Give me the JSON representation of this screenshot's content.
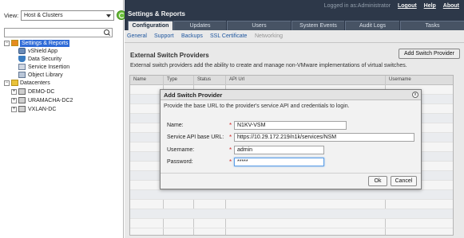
{
  "left": {
    "view_label": "View:",
    "view_select": "Host & Clusters",
    "tree": [
      {
        "label": "Settings & Reports",
        "toggle": "−",
        "icon": "folder-icon"
      },
      {
        "label": "vShield App",
        "icon": "gear-icon"
      },
      {
        "label": "Data Security",
        "icon": "shield-icon"
      },
      {
        "label": "Service Insertion",
        "icon": "service-icon"
      },
      {
        "label": "Object Library",
        "icon": "library-icon"
      },
      {
        "label": "Datacenters",
        "toggle": "−",
        "icon": "folder-icon"
      },
      {
        "label": "DEMO-DC",
        "toggle": "+",
        "icon": "datacenter-icon"
      },
      {
        "label": "URAMACHA-DC2",
        "toggle": "+",
        "icon": "datacenter-icon"
      },
      {
        "label": "VXLAN-DC",
        "toggle": "+",
        "icon": "datacenter-icon"
      }
    ]
  },
  "header": {
    "title": "Settings & Reports",
    "logged_in": "Logged in as:Administrator",
    "logout": "Logout",
    "help": "Help",
    "about": "About"
  },
  "tabs": [
    "Configuration",
    "Updates",
    "Users",
    "System Events",
    "Audit Logs",
    "Tasks"
  ],
  "subtabs": [
    "General",
    "Support",
    "Backups",
    "SSL Certificate",
    "Networking"
  ],
  "panel": {
    "title": "External Switch Providers",
    "add_button": "Add Switch Provider",
    "description": "External switch providers add the ability to create and manage non-VMware implementations of virtual switches.",
    "columns": [
      "Name",
      "Type",
      "Status",
      "API Url",
      "Username"
    ]
  },
  "dialog": {
    "title": "Add Switch Provider",
    "close": "x",
    "description": "Provide the base URL to the provider's service API and credentials to login.",
    "fields": {
      "name_label": "Name:",
      "name_value": "N1KV-VSM",
      "url_label": "Service API base URL:",
      "url_value": "https://10.29.172.219/n1k/services/NSM",
      "username_label": "Username:",
      "username_value": "admin",
      "password_label": "Password:",
      "password_value": "*****"
    },
    "required_mark": "*",
    "ok": "Ok",
    "cancel": "Cancel"
  }
}
